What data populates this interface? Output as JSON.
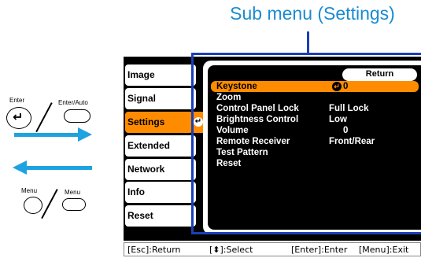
{
  "callout": {
    "title": "Sub menu (Settings)"
  },
  "remote": {
    "enter_label": "Enter",
    "enter_auto_label": "Enter/Auto",
    "menu_label": "Menu",
    "menu_label2": "Menu",
    "enter_glyph": "↵"
  },
  "main_menu": {
    "items": [
      "Image",
      "Signal",
      "Settings",
      "Extended",
      "Network",
      "Info",
      "Reset"
    ],
    "active_index": 2,
    "enter_glyph": "↵"
  },
  "sub_menu": {
    "return_label": "Return",
    "rows": [
      {
        "label": "Keystone",
        "value": "0",
        "selected": true
      },
      {
        "label": "Zoom",
        "value": ""
      },
      {
        "label": "Control Panel Lock",
        "value": "Full Lock"
      },
      {
        "label": "Brightness Control",
        "value": "Low"
      },
      {
        "label": "Volume",
        "value": "0"
      },
      {
        "label": "Remote Receiver",
        "value": "Front/Rear"
      },
      {
        "label": "Test Pattern",
        "value": ""
      },
      {
        "label": "Reset",
        "value": ""
      }
    ],
    "enter_glyph": "↵"
  },
  "footer": {
    "esc": "[Esc]:Return",
    "select": "[⬍]:Select",
    "enter": "[Enter]:Enter",
    "menu": "[Menu]:Exit"
  },
  "colors": {
    "accent": "#ff8c00",
    "callout": "#1a8bd0",
    "frame": "#1a3fb8",
    "arrow": "#1fa3e0"
  }
}
